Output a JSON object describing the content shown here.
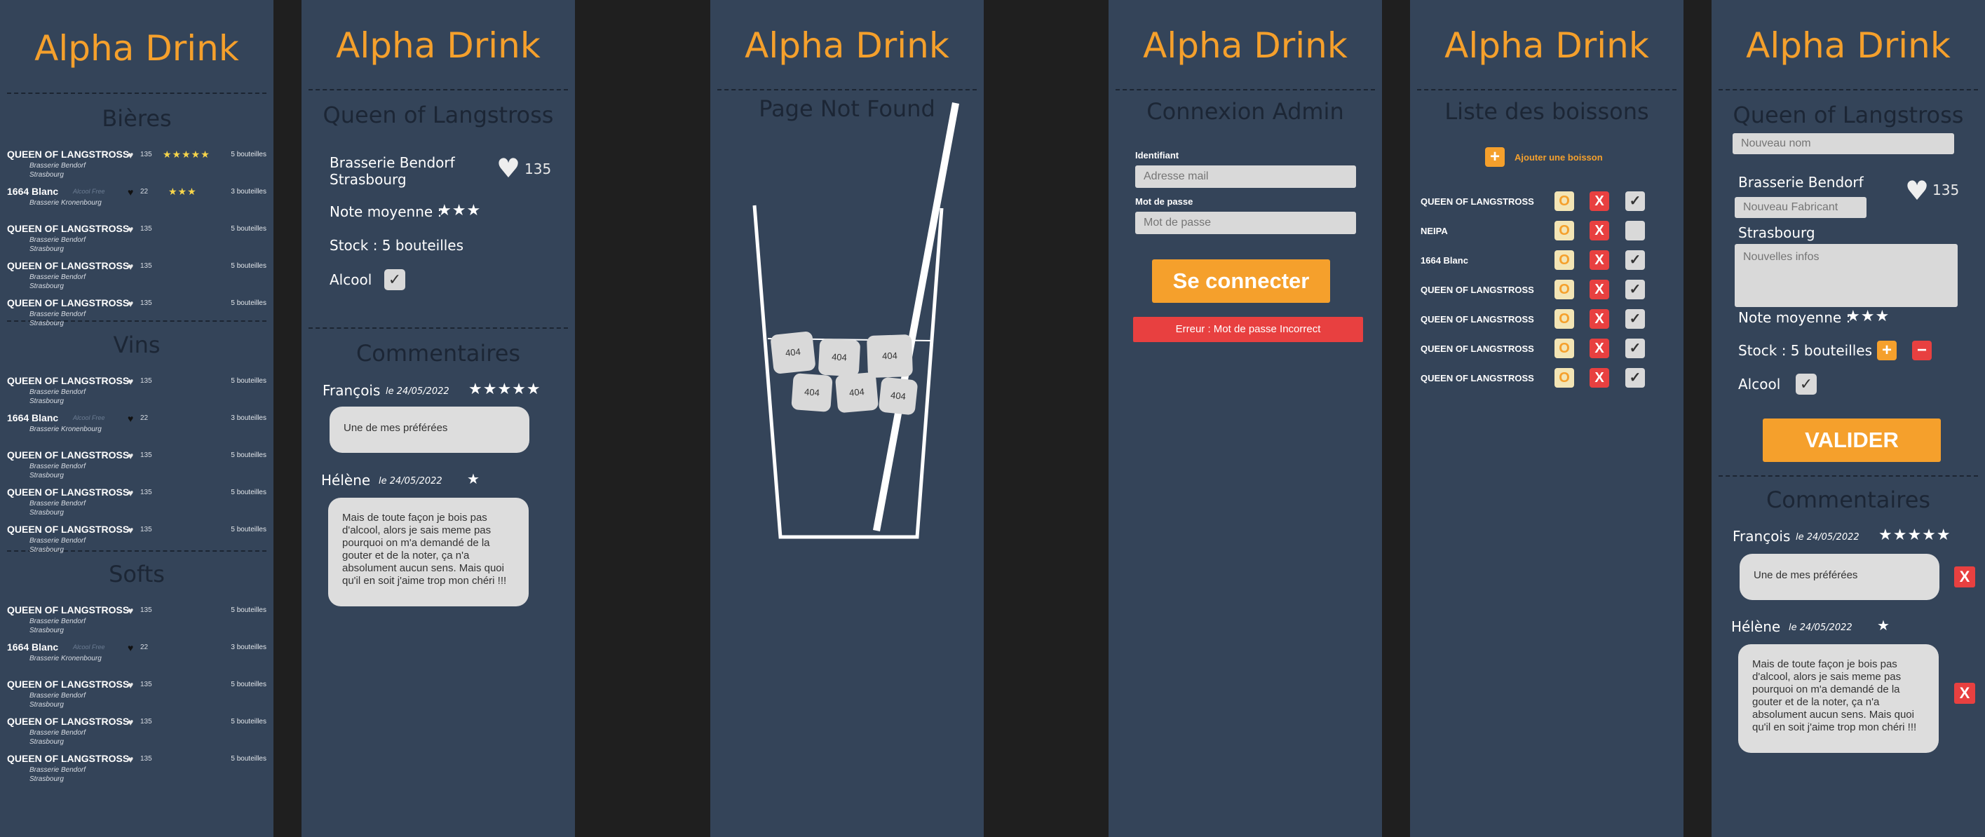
{
  "app_name": "Alpha Drink",
  "list_screen": {
    "sections": [
      {
        "title": "Bières",
        "items": [
          {
            "name": "QUEEN OF LANGSTROSS",
            "maker": "Brasserie Bendorf",
            "city": "Strasbourg",
            "likes": "135",
            "stars": "★★★★★",
            "stock": "5 bouteilles",
            "alcohol_free": ""
          },
          {
            "name": "1664 Blanc",
            "maker": "Brasserie Kronenbourg",
            "city": "",
            "likes": "22",
            "stars": "★★★",
            "stock": "3 bouteilles",
            "alcohol_free": "Alcool Free"
          },
          {
            "name": "QUEEN OF LANGSTROSS",
            "maker": "Brasserie Bendorf",
            "city": "Strasbourg",
            "likes": "135",
            "stars": "",
            "stock": "5 bouteilles",
            "alcohol_free": ""
          },
          {
            "name": "QUEEN OF LANGSTROSS",
            "maker": "Brasserie Bendorf",
            "city": "Strasbourg",
            "likes": "135",
            "stars": "",
            "stock": "5 bouteilles",
            "alcohol_free": ""
          },
          {
            "name": "QUEEN OF LANGSTROSS",
            "maker": "Brasserie Bendorf",
            "city": "Strasbourg",
            "likes": "135",
            "stars": "",
            "stock": "5 bouteilles",
            "alcohol_free": ""
          }
        ]
      },
      {
        "title": "Vins",
        "items": [
          {
            "name": "QUEEN OF LANGSTROSS",
            "maker": "Brasserie Bendorf",
            "city": "Strasbourg",
            "likes": "135",
            "stars": "",
            "stock": "5 bouteilles",
            "alcohol_free": ""
          },
          {
            "name": "1664 Blanc",
            "maker": "Brasserie Kronenbourg",
            "city": "",
            "likes": "22",
            "stars": "",
            "stock": "3 bouteilles",
            "alcohol_free": "Alcool Free"
          },
          {
            "name": "QUEEN OF LANGSTROSS",
            "maker": "Brasserie Bendorf",
            "city": "Strasbourg",
            "likes": "135",
            "stars": "",
            "stock": "5 bouteilles",
            "alcohol_free": ""
          },
          {
            "name": "QUEEN OF LANGSTROSS",
            "maker": "Brasserie Bendorf",
            "city": "Strasbourg",
            "likes": "135",
            "stars": "",
            "stock": "5 bouteilles",
            "alcohol_free": ""
          },
          {
            "name": "QUEEN OF LANGSTROSS",
            "maker": "Brasserie Bendorf",
            "city": "Strasbourg",
            "likes": "135",
            "stars": "",
            "stock": "5 bouteilles",
            "alcohol_free": ""
          }
        ]
      },
      {
        "title": "Softs",
        "items": [
          {
            "name": "QUEEN OF LANGSTROSS",
            "maker": "Brasserie Bendorf",
            "city": "Strasbourg",
            "likes": "135",
            "stars": "",
            "stock": "5 bouteilles",
            "alcohol_free": ""
          },
          {
            "name": "1664 Blanc",
            "maker": "Brasserie Kronenbourg",
            "city": "",
            "likes": "22",
            "stars": "",
            "stock": "3 bouteilles",
            "alcohol_free": "Alcool Free"
          },
          {
            "name": "QUEEN OF LANGSTROSS",
            "maker": "Brasserie Bendorf",
            "city": "Strasbourg",
            "likes": "135",
            "stars": "",
            "stock": "5 bouteilles",
            "alcohol_free": ""
          },
          {
            "name": "QUEEN OF LANGSTROSS",
            "maker": "Brasserie Bendorf",
            "city": "Strasbourg",
            "likes": "135",
            "stars": "",
            "stock": "5 bouteilles",
            "alcohol_free": ""
          },
          {
            "name": "QUEEN OF LANGSTROSS",
            "maker": "Brasserie Bendorf",
            "city": "Strasbourg",
            "likes": "135",
            "stars": "",
            "stock": "5 bouteilles",
            "alcohol_free": ""
          }
        ]
      }
    ]
  },
  "detail_screen": {
    "title": "Queen of Langstross",
    "maker": "Brasserie Bendorf",
    "city": "Strasbourg",
    "likes": "135",
    "rating_label": "Note moyenne :",
    "rating_stars": "★★★",
    "stock_label": "Stock : 5 bouteilles",
    "alcohol_label": "Alcool",
    "alcohol_check": "✓",
    "comments_title": "Commentaires",
    "comments": [
      {
        "author": "François",
        "date": "le 24/05/2022",
        "stars": "★★★★★",
        "text": "Une de mes préférées"
      },
      {
        "author": "Hélène",
        "date": "le 24/05/2022",
        "stars": "★",
        "text": "Mais de toute façon je bois pas d'alcool, alors je sais meme pas pourquoi on m'a demandé de la gouter et de la noter, ça n'a absolument aucun sens. Mais quoi qu'il en soit j'aime trop mon chéri !!!"
      }
    ]
  },
  "not_found_screen": {
    "title": "Page Not Found",
    "ice_cube_text": "404"
  },
  "login_screen": {
    "title": "Connexion Admin",
    "id_label": "Identifiant",
    "id_placeholder": "Adresse mail",
    "pw_label": "Mot de passe",
    "pw_placeholder": "Mot de passe",
    "submit_label": "Se connecter",
    "error_text": "Erreur : Mot de passe Incorrect"
  },
  "admin_list_screen": {
    "title": "Liste des boissons",
    "add_label": "Ajouter une boisson",
    "edit_glyph": "O",
    "delete_glyph": "X",
    "check_glyph": "✓",
    "drinks": [
      {
        "name": "QUEEN OF LANGSTROSS",
        "checked": true
      },
      {
        "name": "NEIPA",
        "checked": false
      },
      {
        "name": "1664 Blanc",
        "checked": true
      },
      {
        "name": "QUEEN OF LANGSTROSS",
        "checked": true
      },
      {
        "name": "QUEEN OF LANGSTROSS",
        "checked": true
      },
      {
        "name": "QUEEN OF LANGSTROSS",
        "checked": true
      },
      {
        "name": "QUEEN OF LANGSTROSS",
        "checked": true
      }
    ]
  },
  "edit_screen": {
    "title": "Queen of Langstross",
    "name_placeholder": "Nouveau nom",
    "maker": "Brasserie Bendorf",
    "maker_placeholder": "Nouveau Fabricant",
    "likes": "135",
    "city": "Strasbourg",
    "info_placeholder": "Nouvelles infos",
    "rating_label": "Note moyenne :",
    "rating_stars": "★★★",
    "stock_label": "Stock : 5 bouteilles",
    "plus_glyph": "+",
    "minus_glyph": "−",
    "alcohol_label": "Alcool",
    "alcohol_check": "✓",
    "validate_label": "VALIDER",
    "comments_title": "Commentaires",
    "delete_glyph": "X",
    "comments": [
      {
        "author": "François",
        "date": "le 24/05/2022",
        "stars": "★★★★★",
        "text": "Une de mes préférées"
      },
      {
        "author": "Hélène",
        "date": "le 24/05/2022",
        "stars": "★",
        "text": "Mais de toute façon je bois pas d'alcool, alors je sais meme pas pourquoi on m'a demandé de la gouter et de la noter, ça n'a absolument aucun sens. Mais quoi qu'il en soit j'aime trop mon chéri !!!"
      }
    ]
  },
  "colors": {
    "panel_bg": "#344459",
    "page_bg": "#1f1f1f",
    "brand": "#f5a02c",
    "danger": "#e84040",
    "field_bg": "#d9d9d9"
  }
}
